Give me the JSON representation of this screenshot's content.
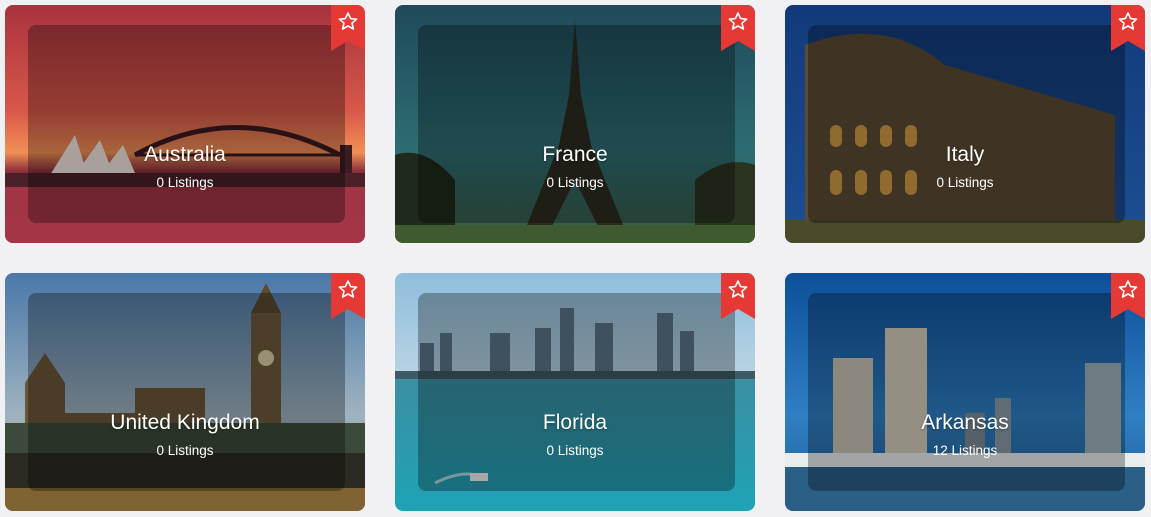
{
  "colors": {
    "bookmark": "#e53935",
    "card_overlay": "rgba(0,0,0,0.30)"
  },
  "cards": [
    {
      "name": "Australia",
      "listings": "0 Listings",
      "icon": "star-icon"
    },
    {
      "name": "France",
      "listings": "0 Listings",
      "icon": "star-icon"
    },
    {
      "name": "Italy",
      "listings": "0 Listings",
      "icon": "star-icon"
    },
    {
      "name": "United Kingdom",
      "listings": "0 Listings",
      "icon": "star-icon"
    },
    {
      "name": "Florida",
      "listings": "0 Listings",
      "icon": "star-icon"
    },
    {
      "name": "Arkansas",
      "listings": "12 Listings",
      "icon": "star-icon"
    }
  ]
}
